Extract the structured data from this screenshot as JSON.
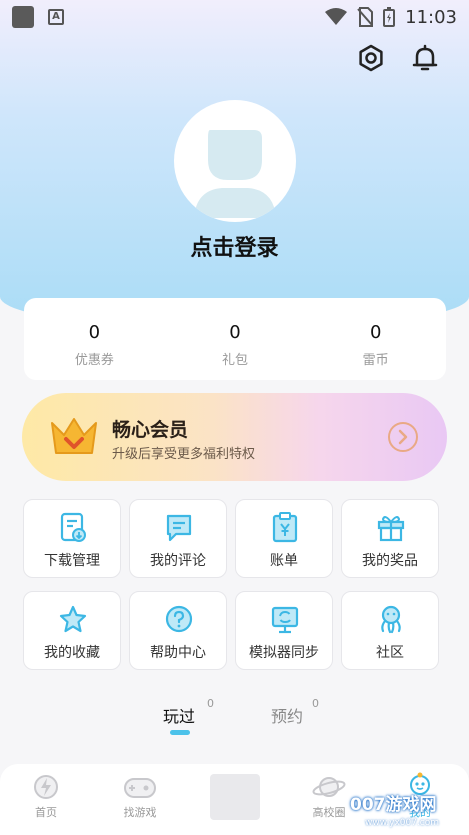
{
  "status_bar": {
    "time": "11:03",
    "app_icon_letter": "A"
  },
  "header": {
    "settings_icon": "gear-icon",
    "notification_icon": "bell-icon"
  },
  "profile": {
    "login_text": "点击登录"
  },
  "stats": [
    {
      "value": "0",
      "label": "优惠券"
    },
    {
      "value": "0",
      "label": "礼包"
    },
    {
      "value": "0",
      "label": "雷币"
    }
  ],
  "vip": {
    "title": "畅心会员",
    "subtitle": "升级后享受更多福利特权"
  },
  "menu": [
    {
      "label": "下载管理",
      "icon": "download-doc-icon"
    },
    {
      "label": "我的评论",
      "icon": "comment-icon"
    },
    {
      "label": "账单",
      "icon": "bill-icon"
    },
    {
      "label": "我的奖品",
      "icon": "gift-icon"
    },
    {
      "label": "我的收藏",
      "icon": "star-icon"
    },
    {
      "label": "帮助中心",
      "icon": "help-icon"
    },
    {
      "label": "模拟器同步",
      "icon": "sync-monitor-icon"
    },
    {
      "label": "社区",
      "icon": "community-icon"
    }
  ],
  "tabs": [
    {
      "label": "玩过",
      "count": "0",
      "active": true
    },
    {
      "label": "预约",
      "count": "0",
      "active": false
    }
  ],
  "bottom_nav": [
    {
      "label": "首页",
      "icon": "home-bolt-icon"
    },
    {
      "label": "找游戏",
      "icon": "gamepad-icon"
    },
    {
      "label": "",
      "icon": "center-placeholder"
    },
    {
      "label": "高校圈",
      "icon": "planet-icon"
    },
    {
      "label": "我的",
      "icon": "mascot-icon"
    }
  ],
  "watermark": {
    "text": "007游戏网",
    "url": "www.yx007.com"
  },
  "colors": {
    "accent": "#4cc2ea",
    "icon_blue": "#3cb7e4"
  }
}
